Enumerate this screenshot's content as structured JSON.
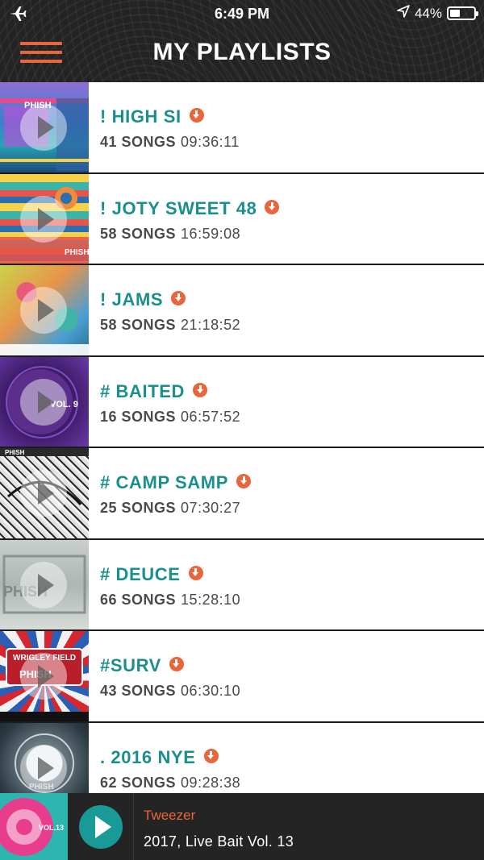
{
  "status_bar": {
    "time": "6:49 PM",
    "battery_text": "44%",
    "battery_level": 0.44,
    "icons": [
      "airplane-icon",
      "location-icon",
      "battery-icon"
    ]
  },
  "header": {
    "title": "MY PLAYLISTS",
    "accent_color": "#e8663b"
  },
  "colors": {
    "title_teal": "#1a8f8c",
    "accent_orange": "#e8663b",
    "meta_gray": "#4a4a4a"
  },
  "playlists": [
    {
      "title": "! HIGH SI",
      "songs": "41 SONGS",
      "duration": "09:36:11"
    },
    {
      "title": "! JOTY SWEET 48",
      "songs": "58 SONGS",
      "duration": "16:59:08"
    },
    {
      "title": "! JAMS",
      "songs": "58 SONGS",
      "duration": "21:18:52"
    },
    {
      "title": "# BAITED",
      "songs": "16 SONGS",
      "duration": "06:57:52"
    },
    {
      "title": "# CAMP SAMP",
      "songs": "25 SONGS",
      "duration": "07:30:27"
    },
    {
      "title": "# DEUCE",
      "songs": "66 SONGS",
      "duration": "15:28:10"
    },
    {
      "title": "#SURV",
      "songs": "43 SONGS",
      "duration": "06:30:10"
    },
    {
      "title": ". 2016 NYE",
      "songs": "62 SONGS",
      "duration": "09:28:38"
    }
  ],
  "now_playing": {
    "track": "Tweezer",
    "album": "2017, Live Bait Vol. 13"
  }
}
